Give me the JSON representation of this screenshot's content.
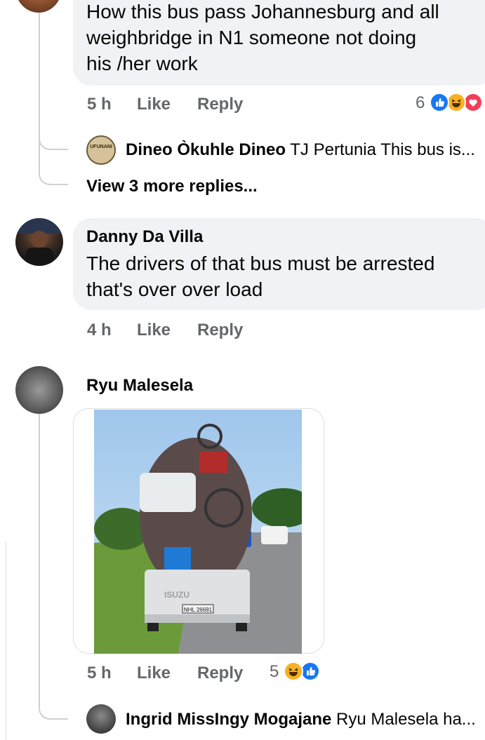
{
  "comment1": {
    "text_lines": [
      "How this bus pass Johannesburg and all",
      "weighbridge in N1 someone not doing",
      "his /her work"
    ],
    "time": "5 h",
    "like": "Like",
    "reply": "Reply",
    "reaction_count": "6",
    "reactions": [
      "like-icon",
      "haha-icon",
      "love-icon"
    ],
    "reply_preview": {
      "avatar_text": "UFUNANI",
      "author": "Dineo Òkuhle Dineo",
      "text": "TJ Pertunia This bus is..."
    },
    "view_more": "View 3 more replies..."
  },
  "comment2": {
    "author": "Danny Da Villa",
    "text_lines": [
      "The drivers of that bus must be arrested",
      "that's over over load"
    ],
    "time": "4 h",
    "like": "Like",
    "reply": "Reply"
  },
  "comment3": {
    "author": "Ryu Malesela",
    "image_plate": "NHL 26691",
    "image_brand": "ISUZU",
    "time": "5 h",
    "like": "Like",
    "reply": "Reply",
    "reaction_count": "5",
    "reactions": [
      "haha-icon",
      "like-icon"
    ],
    "reply_preview": {
      "author": "Ingrid MissIngy Mogajane",
      "text": "Ryu Malesela ha..."
    }
  },
  "colors": {
    "bubble": "#f0f2f5",
    "meta": "#65676b",
    "like_blue": "#1877f2",
    "haha_yellow": "#f7b125",
    "love_red": "#f33e58"
  }
}
